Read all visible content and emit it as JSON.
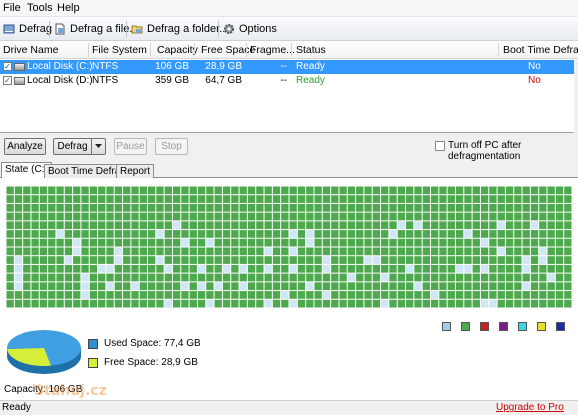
{
  "menu": [
    "File",
    "Tools",
    "Help"
  ],
  "toolbar": {
    "defrag": "Defrag",
    "defrag_file": "Defrag a file...",
    "defrag_folder": "Defrag a folder...",
    "options": "Options"
  },
  "drive_list": {
    "columns": [
      "Drive Name",
      "File System",
      "Capacity",
      "Free Space",
      "Fragme...",
      "Status",
      "Boot Time Defrag"
    ],
    "rows": [
      {
        "name": "Local Disk (C:)",
        "fs": "NTFS",
        "capacity": "106 GB",
        "free": "28,9 GB",
        "frag": "--",
        "status": "Ready",
        "boot": "No",
        "checked": true,
        "selected": true
      },
      {
        "name": "Local Disk (D:)",
        "fs": "NTFS",
        "capacity": "359 GB",
        "free": "64,7 GB",
        "frag": "--",
        "status": "Ready",
        "boot": "No",
        "checked": true,
        "selected": false
      }
    ]
  },
  "actions": {
    "analyze": "Analyze",
    "defrag": "Defrag",
    "pause": "Pause",
    "stop": "Stop",
    "turn_off_label": "Turn off PC after defragmentation"
  },
  "tabs": [
    "State (C:)",
    "Boot Time Defrag",
    "Report"
  ],
  "legend_colors": [
    "#a6cbe8",
    "#4ea94e",
    "#cc1f1f",
    "#7a1e8a",
    "#38d8e8",
    "#e6dc2a",
    "#1f2aa6"
  ],
  "disk_map": {
    "colors": {
      "used": "#4ea94e",
      "free": "#cfe6f5"
    }
  },
  "usage": {
    "used_label": "Used Space: 77,4 GB",
    "free_label": "Free Space: 28,9 GB",
    "used_color": "#2f8fd0",
    "free_color": "#d6ee3a",
    "used_fraction": 0.73
  },
  "capacity": "Capacity: 106 GB",
  "watermark": "Stahuj.cz",
  "status": {
    "text": "Ready",
    "upgrade": "Upgrade to Pro"
  }
}
